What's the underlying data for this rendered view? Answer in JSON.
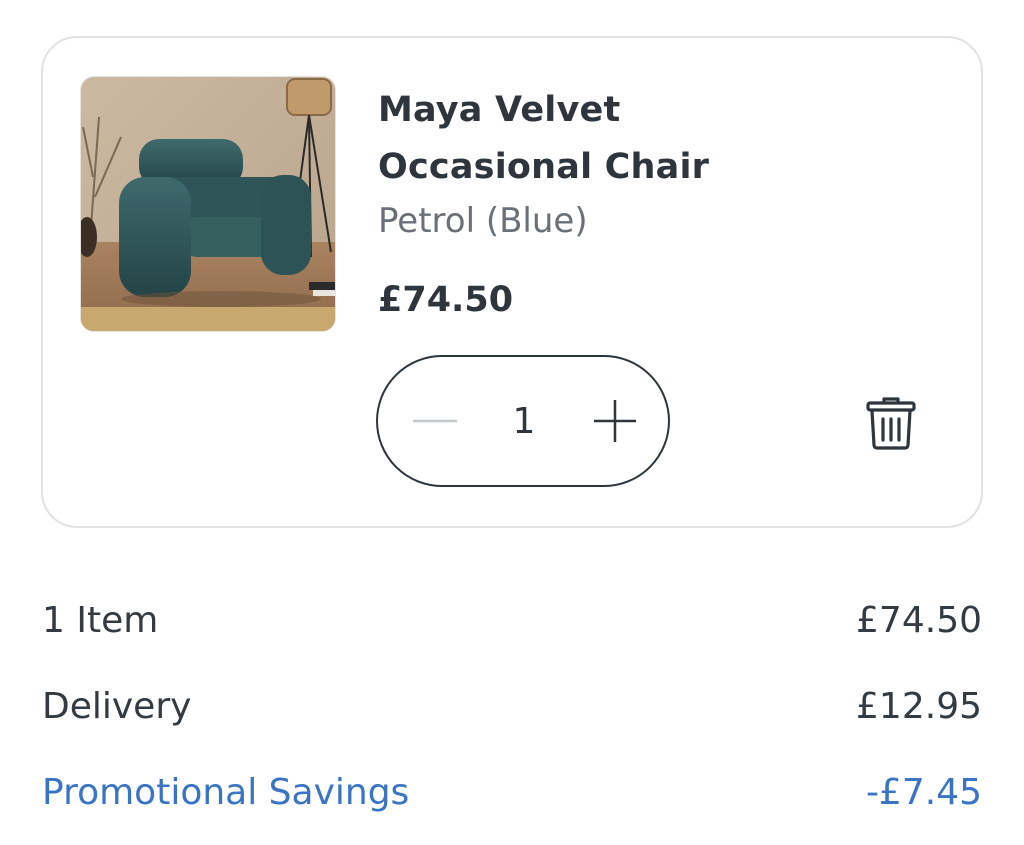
{
  "cart_item": {
    "image_alt": "Maya Velvet Occasional Chair",
    "title": "Maya Velvet Occasional Chair",
    "variant": "Petrol (Blue)",
    "price": "£74.50",
    "quantity": "1",
    "decrease_icon": "minus-icon",
    "increase_icon": "plus-icon",
    "delete_icon": "trash-icon"
  },
  "summary": {
    "items_label": "1 Item",
    "items_value": "£74.50",
    "delivery_label": "Delivery",
    "delivery_value": "£12.95",
    "promo_label": "Promotional Savings",
    "promo_value": "-£7.45"
  },
  "colors": {
    "text_primary": "#2f353d",
    "text_secondary": "#6b7078",
    "promo": "#3a74c4",
    "card_border": "#e0e2e5"
  }
}
